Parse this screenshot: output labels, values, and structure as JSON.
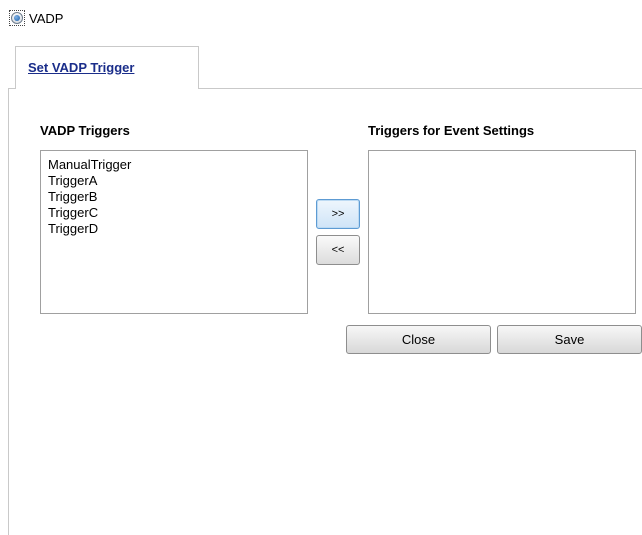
{
  "mode": {
    "label": "VADP",
    "selected": true
  },
  "tab": {
    "label": "Set VADP Trigger"
  },
  "available": {
    "title": "VADP Triggers",
    "items": [
      "ManualTrigger",
      "TriggerA",
      "TriggerB",
      "TriggerC",
      "TriggerD"
    ]
  },
  "selected_triggers": {
    "title": "Triggers for Event Settings",
    "items": []
  },
  "controls": {
    "add_label": ">>",
    "remove_label": "<<",
    "close_label": "Close",
    "save_label": "Save"
  }
}
